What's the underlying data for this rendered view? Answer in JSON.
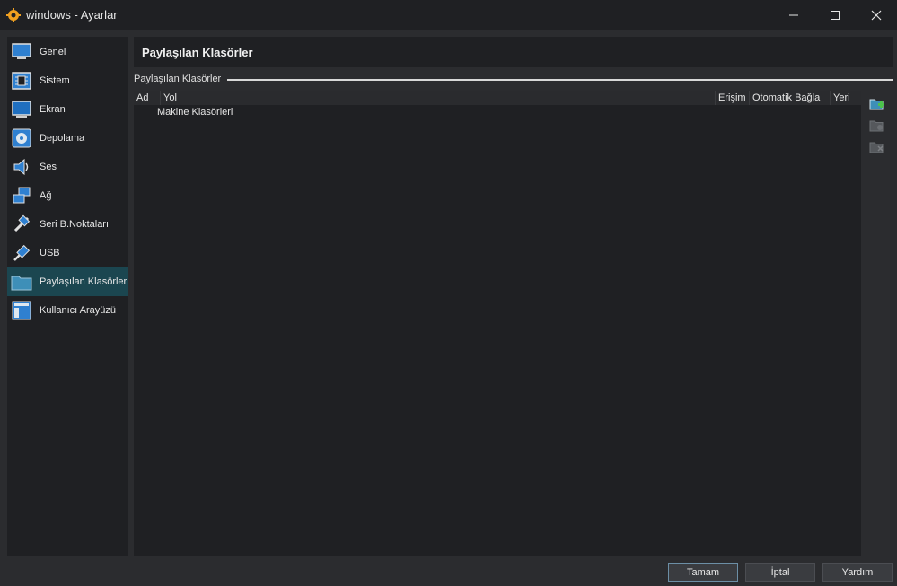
{
  "window": {
    "title": "windows - Ayarlar"
  },
  "sidebar": {
    "items": [
      {
        "label": "Genel",
        "icon": "monitor-general-icon"
      },
      {
        "label": "Sistem",
        "icon": "chip-icon"
      },
      {
        "label": "Ekran",
        "icon": "display-icon"
      },
      {
        "label": "Depolama",
        "icon": "disk-icon"
      },
      {
        "label": "Ses",
        "icon": "speaker-icon"
      },
      {
        "label": "Ağ",
        "icon": "network-icon"
      },
      {
        "label": "Seri B.Noktaları",
        "icon": "serial-port-icon"
      },
      {
        "label": "USB",
        "icon": "usb-icon"
      },
      {
        "label": "Paylaşılan Klasörler",
        "icon": "folder-icon"
      },
      {
        "label": "Kullanıcı Arayüzü",
        "icon": "ui-window-icon"
      }
    ],
    "active_index": 8
  },
  "main": {
    "title": "Paylaşılan Klasörler",
    "group_label_pre": "Paylaşılan ",
    "group_label_ul": "K",
    "group_label_post": "lasörler",
    "columns": [
      "Ad",
      "Yol",
      "Erişim",
      "Otomatik Bağla",
      "Yeri"
    ],
    "rows": [
      "Makine Klasörleri"
    ],
    "tools": [
      "add-shared-folder-icon",
      "edit-shared-folder-icon",
      "remove-shared-folder-icon"
    ]
  },
  "buttons": {
    "ok": "Tamam",
    "cancel": "İptal",
    "help": "Yardım"
  },
  "colors": {
    "accent": "#1b4650",
    "background": "#2b2c2f",
    "panel": "#1f2023"
  }
}
